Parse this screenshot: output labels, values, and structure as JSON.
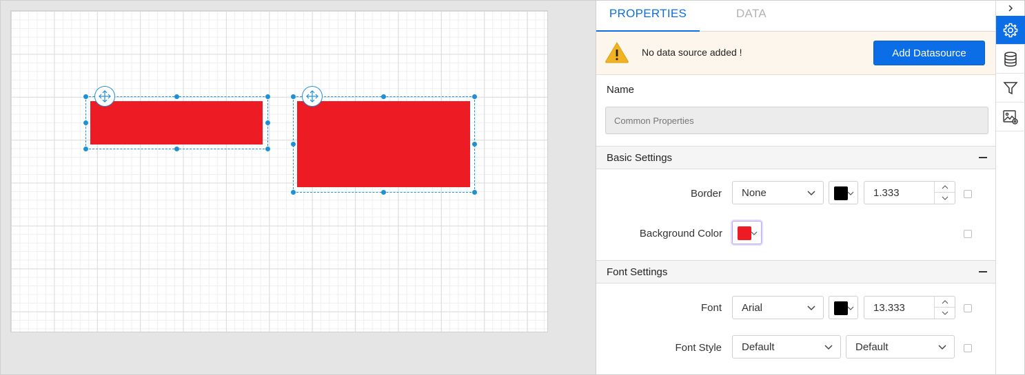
{
  "canvas": {
    "items": [
      {
        "name": "rectangle-1",
        "fill": "#ed1c24"
      },
      {
        "name": "rectangle-2",
        "fill": "#ed1c24"
      }
    ],
    "selection_color": "#1e90d6"
  },
  "tabs": {
    "properties": "PROPERTIES",
    "data": "DATA"
  },
  "alert": {
    "message": "No data source added !",
    "button_label": "Add Datasource"
  },
  "name_field": {
    "label": "Name",
    "placeholder": "Common Properties"
  },
  "basic_settings": {
    "title": "Basic Settings",
    "border_label": "Border",
    "border_style": "None",
    "border_color": "#000000",
    "border_width": "1.333",
    "background_label": "Background Color",
    "background_color": "#ed1c24"
  },
  "font_settings": {
    "title": "Font Settings",
    "font_label": "Font",
    "font_family": "Arial",
    "font_color": "#000000",
    "font_size": "13.333",
    "style_label": "Font Style",
    "style_value": "Default",
    "weight_value": "Default"
  },
  "side_strip": {
    "icons": [
      "chevron-right-icon",
      "gear-icon",
      "database-icon",
      "filter-icon",
      "image-settings-icon"
    ],
    "accent": "#0b6ee6"
  }
}
